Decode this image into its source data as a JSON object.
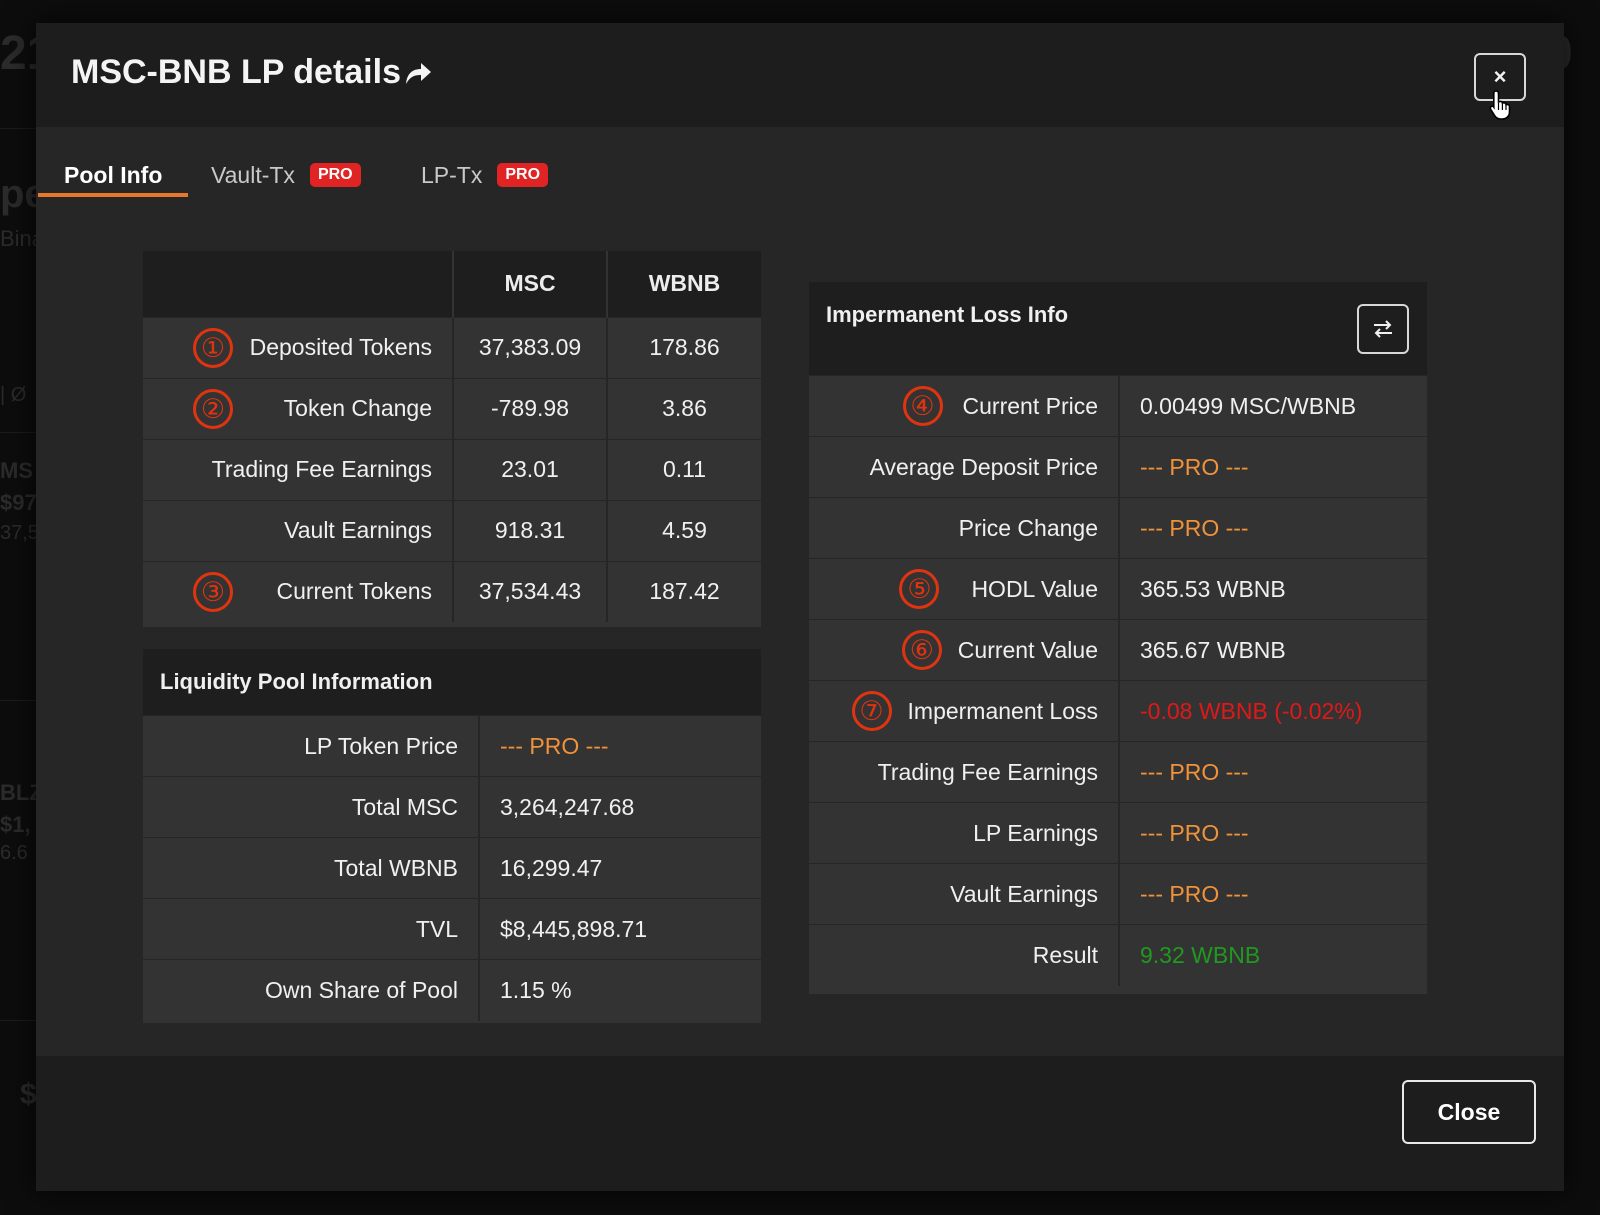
{
  "background": {
    "fragments": [
      "21",
      "0",
      "pe",
      "Bina",
      "| Ø",
      "MS",
      "$97",
      "37,5",
      "BLZ",
      "$1,",
      "6.6",
      "$"
    ]
  },
  "modal": {
    "title": "MSC-BNB LP details",
    "close_icon": "×",
    "tabs": [
      {
        "label": "Pool Info",
        "active": true
      },
      {
        "label": "Vault-Tx",
        "badge": "PRO"
      },
      {
        "label": "LP-Tx",
        "badge": "PRO"
      }
    ],
    "tokens_table": {
      "headers": [
        "",
        "MSC",
        "WBNB"
      ],
      "rows": [
        {
          "marker": "①",
          "label": "Deposited Tokens",
          "msc": "37,383.09",
          "wbnb": "178.86"
        },
        {
          "marker": "②",
          "label": "Token Change",
          "msc": "-789.98",
          "wbnb": "3.86"
        },
        {
          "marker": "",
          "label": "Trading Fee Earnings",
          "msc": "23.01",
          "wbnb": "0.11"
        },
        {
          "marker": "",
          "label": "Vault Earnings",
          "msc": "918.31",
          "wbnb": "4.59"
        },
        {
          "marker": "③",
          "label": "Current Tokens",
          "msc": "37,534.43",
          "wbnb": "187.42"
        }
      ]
    },
    "lp_info": {
      "title": "Liquidity Pool Information",
      "rows": [
        {
          "label": "LP Token Price",
          "value": "--- PRO ---",
          "style": "pro"
        },
        {
          "label": "Total MSC",
          "value": "3,264,247.68"
        },
        {
          "label": "Total WBNB",
          "value": "16,299.47"
        },
        {
          "label": "TVL",
          "value": "$8,445,898.71"
        },
        {
          "label": "Own Share of Pool",
          "value": "1.15 %"
        }
      ]
    },
    "il_info": {
      "title": "Impermanent Loss Info",
      "swap_icon": "⇄",
      "rows": [
        {
          "marker": "④",
          "label": "Current Price",
          "value": "0.00499 MSC/WBNB"
        },
        {
          "marker": "",
          "label": "Average Deposit Price",
          "value": "--- PRO ---",
          "style": "pro"
        },
        {
          "marker": "",
          "label": "Price Change",
          "value": "--- PRO ---",
          "style": "pro"
        },
        {
          "marker": "⑤",
          "label": "HODL Value",
          "value": "365.53 WBNB"
        },
        {
          "marker": "⑥",
          "label": "Current Value",
          "value": "365.67 WBNB"
        },
        {
          "marker": "⑦",
          "label": "Impermanent Loss",
          "value": "-0.08 WBNB (-0.02%)",
          "style": "loss"
        },
        {
          "marker": "",
          "label": "Trading Fee Earnings",
          "value": "--- PRO ---",
          "style": "pro"
        },
        {
          "marker": "",
          "label": "LP Earnings",
          "value": "--- PRO ---",
          "style": "pro"
        },
        {
          "marker": "",
          "label": "Vault Earnings",
          "value": "--- PRO ---",
          "style": "pro"
        },
        {
          "marker": "",
          "label": "Result",
          "value": "9.32 WBNB",
          "style": "gain"
        }
      ]
    },
    "footer": {
      "close_label": "Close"
    },
    "colors": {
      "accent": "#e8772e",
      "pro_badge": "#e02424",
      "pro_text": "#f0923a",
      "loss": "#e01818",
      "gain": "#1f9a1f",
      "marker": "#e03410"
    }
  }
}
